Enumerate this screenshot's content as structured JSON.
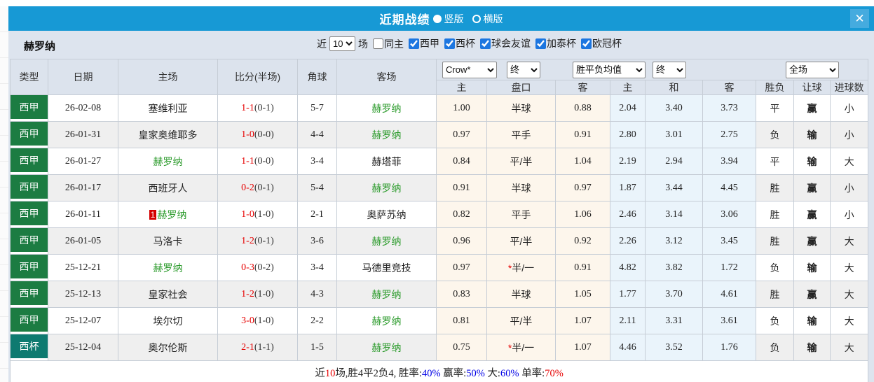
{
  "window": {
    "title": "近期战绩",
    "close_icon": "✕",
    "layout_options": [
      {
        "label": "竖版",
        "selected": true
      },
      {
        "label": "横版",
        "selected": false
      }
    ]
  },
  "filter": {
    "team": "赫罗纳",
    "recent_label": "近",
    "recent_count": "10",
    "games_label": "场",
    "same_home": {
      "label": "同主",
      "checked": false
    },
    "competitions": [
      {
        "label": "西甲",
        "checked": true
      },
      {
        "label": "西杯",
        "checked": true
      },
      {
        "label": "球会友谊",
        "checked": true
      },
      {
        "label": "加泰杯",
        "checked": true
      },
      {
        "label": "欧冠杯",
        "checked": true
      }
    ]
  },
  "table": {
    "selectors": {
      "bookmaker": "Crow*",
      "bookmaker_time": "终",
      "average": "胜平负均值",
      "average_time": "终",
      "scope": "全场"
    },
    "headers": {
      "type": "类型",
      "date": "日期",
      "home": "主场",
      "score": "比分(半场)",
      "corners": "角球",
      "away": "客场",
      "odds_home": "主",
      "odds_line": "盘口",
      "odds_away": "客",
      "avg_home": "主",
      "avg_draw": "和",
      "avg_away": "客",
      "result": "胜负",
      "handicap": "让球",
      "goals": "进球数"
    },
    "rows": [
      {
        "type": "西甲",
        "type_style": "league",
        "date": "26-02-08",
        "home": "塞维利亚",
        "home_is_focus": false,
        "home_badge": "",
        "score": "1-1",
        "half_score": "(0-1)",
        "corners": "5-7",
        "away": "赫罗纳",
        "away_is_focus": true,
        "odds_home": "1.00",
        "odds_line": "半球",
        "odds_away": "0.88",
        "avg_home": "2.04",
        "avg_draw": "3.40",
        "avg_away": "3.73",
        "result": "平",
        "result_style": "blue",
        "handicap": "赢",
        "handicap_style": "red",
        "goals": "小",
        "goals_style": "green"
      },
      {
        "type": "西甲",
        "type_style": "league",
        "date": "26-01-31",
        "home": "皇家奥维耶多",
        "home_is_focus": false,
        "home_badge": "",
        "score": "1-0",
        "half_score": "(0-0)",
        "corners": "4-4",
        "away": "赫罗纳",
        "away_is_focus": true,
        "odds_home": "0.97",
        "odds_line": "平手",
        "odds_away": "0.91",
        "avg_home": "2.80",
        "avg_draw": "3.01",
        "avg_away": "2.75",
        "result": "负",
        "result_style": "green",
        "handicap": "输",
        "handicap_style": "green",
        "goals": "小",
        "goals_style": "green"
      },
      {
        "type": "西甲",
        "type_style": "league",
        "date": "26-01-27",
        "home": "赫罗纳",
        "home_is_focus": true,
        "home_badge": "",
        "score": "1-1",
        "half_score": "(0-0)",
        "corners": "3-4",
        "away": "赫塔菲",
        "away_is_focus": false,
        "odds_home": "0.84",
        "odds_line": "平/半",
        "odds_away": "1.04",
        "avg_home": "2.19",
        "avg_draw": "2.94",
        "avg_away": "3.94",
        "result": "平",
        "result_style": "blue",
        "handicap": "输",
        "handicap_style": "green",
        "goals": "大",
        "goals_style": "red"
      },
      {
        "type": "西甲",
        "type_style": "league",
        "date": "26-01-17",
        "home": "西班牙人",
        "home_is_focus": false,
        "home_badge": "",
        "score": "0-2",
        "half_score": "(0-1)",
        "corners": "5-4",
        "away": "赫罗纳",
        "away_is_focus": true,
        "odds_home": "0.91",
        "odds_line": "半球",
        "odds_away": "0.97",
        "avg_home": "1.87",
        "avg_draw": "3.44",
        "avg_away": "4.45",
        "result": "胜",
        "result_style": "red",
        "handicap": "赢",
        "handicap_style": "red",
        "goals": "小",
        "goals_style": "green"
      },
      {
        "type": "西甲",
        "type_style": "league",
        "date": "26-01-11",
        "home": "赫罗纳",
        "home_is_focus": true,
        "home_badge": "1",
        "score": "1-0",
        "half_score": "(1-0)",
        "corners": "2-1",
        "away": "奥萨苏纳",
        "away_is_focus": false,
        "odds_home": "0.82",
        "odds_line": "平手",
        "odds_away": "1.06",
        "avg_home": "2.46",
        "avg_draw": "3.14",
        "avg_away": "3.06",
        "result": "胜",
        "result_style": "red",
        "handicap": "赢",
        "handicap_style": "red",
        "goals": "小",
        "goals_style": "green"
      },
      {
        "type": "西甲",
        "type_style": "league",
        "date": "26-01-05",
        "home": "马洛卡",
        "home_is_focus": false,
        "home_badge": "",
        "score": "1-2",
        "half_score": "(0-1)",
        "corners": "3-6",
        "away": "赫罗纳",
        "away_is_focus": true,
        "odds_home": "0.96",
        "odds_line": "平/半",
        "odds_away": "0.92",
        "avg_home": "2.26",
        "avg_draw": "3.12",
        "avg_away": "3.45",
        "result": "胜",
        "result_style": "red",
        "handicap": "赢",
        "handicap_style": "red",
        "goals": "大",
        "goals_style": "red"
      },
      {
        "type": "西甲",
        "type_style": "league",
        "date": "25-12-21",
        "home": "赫罗纳",
        "home_is_focus": true,
        "home_badge": "",
        "score": "0-3",
        "half_score": "(0-2)",
        "corners": "3-4",
        "away": "马德里竞技",
        "away_is_focus": false,
        "odds_home": "0.97",
        "odds_line": "*半/一",
        "odds_away": "0.91",
        "avg_home": "4.82",
        "avg_draw": "3.82",
        "avg_away": "1.72",
        "result": "负",
        "result_style": "green",
        "handicap": "输",
        "handicap_style": "green",
        "goals": "大",
        "goals_style": "red"
      },
      {
        "type": "西甲",
        "type_style": "league",
        "date": "25-12-13",
        "home": "皇家社会",
        "home_is_focus": false,
        "home_badge": "",
        "score": "1-2",
        "half_score": "(1-0)",
        "corners": "4-3",
        "away": "赫罗纳",
        "away_is_focus": true,
        "odds_home": "0.83",
        "odds_line": "半球",
        "odds_away": "1.05",
        "avg_home": "1.77",
        "avg_draw": "3.70",
        "avg_away": "4.61",
        "result": "胜",
        "result_style": "red",
        "handicap": "赢",
        "handicap_style": "red",
        "goals": "大",
        "goals_style": "red"
      },
      {
        "type": "西甲",
        "type_style": "league",
        "date": "25-12-07",
        "home": "埃尔切",
        "home_is_focus": false,
        "home_badge": "",
        "score": "3-0",
        "half_score": "(1-0)",
        "corners": "2-2",
        "away": "赫罗纳",
        "away_is_focus": true,
        "odds_home": "0.81",
        "odds_line": "平/半",
        "odds_away": "1.07",
        "avg_home": "2.11",
        "avg_draw": "3.31",
        "avg_away": "3.61",
        "result": "负",
        "result_style": "green",
        "handicap": "输",
        "handicap_style": "green",
        "goals": "大",
        "goals_style": "red"
      },
      {
        "type": "西杯",
        "type_style": "cup",
        "date": "25-12-04",
        "home": "奥尔伦斯",
        "home_is_focus": false,
        "home_badge": "",
        "score": "2-1",
        "half_score": "(1-1)",
        "corners": "1-5",
        "away": "赫罗纳",
        "away_is_focus": true,
        "odds_home": "0.75",
        "odds_line": "*半/一",
        "odds_away": "1.07",
        "avg_home": "4.46",
        "avg_draw": "3.52",
        "avg_away": "1.76",
        "result": "负",
        "result_style": "green",
        "handicap": "输",
        "handicap_style": "green",
        "goals": "大",
        "goals_style": "red"
      }
    ]
  },
  "summary": {
    "segments": [
      {
        "text": "近",
        "color": "dark"
      },
      {
        "text": "10",
        "color": "red"
      },
      {
        "text": "场,胜4平2负4, 胜率:",
        "color": "dark"
      },
      {
        "text": "40%",
        "color": "blue"
      },
      {
        "text": " 赢率:",
        "color": "dark"
      },
      {
        "text": "50%",
        "color": "blue"
      },
      {
        "text": " 大:",
        "color": "dark"
      },
      {
        "text": "60%",
        "color": "blue"
      },
      {
        "text": " 单率:",
        "color": "dark"
      },
      {
        "text": "70%",
        "color": "red"
      }
    ]
  },
  "colors": {
    "titlebar_blue": "#1799d5",
    "panel_background": "#dde4ee",
    "league_badge_green": "#1c7c42",
    "cup_badge_teal": "#0e7a70",
    "focus_team_green": "#2a9a2a",
    "score_red": "#e60000",
    "win_red": "#cc1414",
    "lose_green": "#1d8a1d",
    "draw_blue": "#1515cc",
    "odds_column_cream": "#fdf6ec",
    "avg_column_blue": "#eaf4fb"
  }
}
